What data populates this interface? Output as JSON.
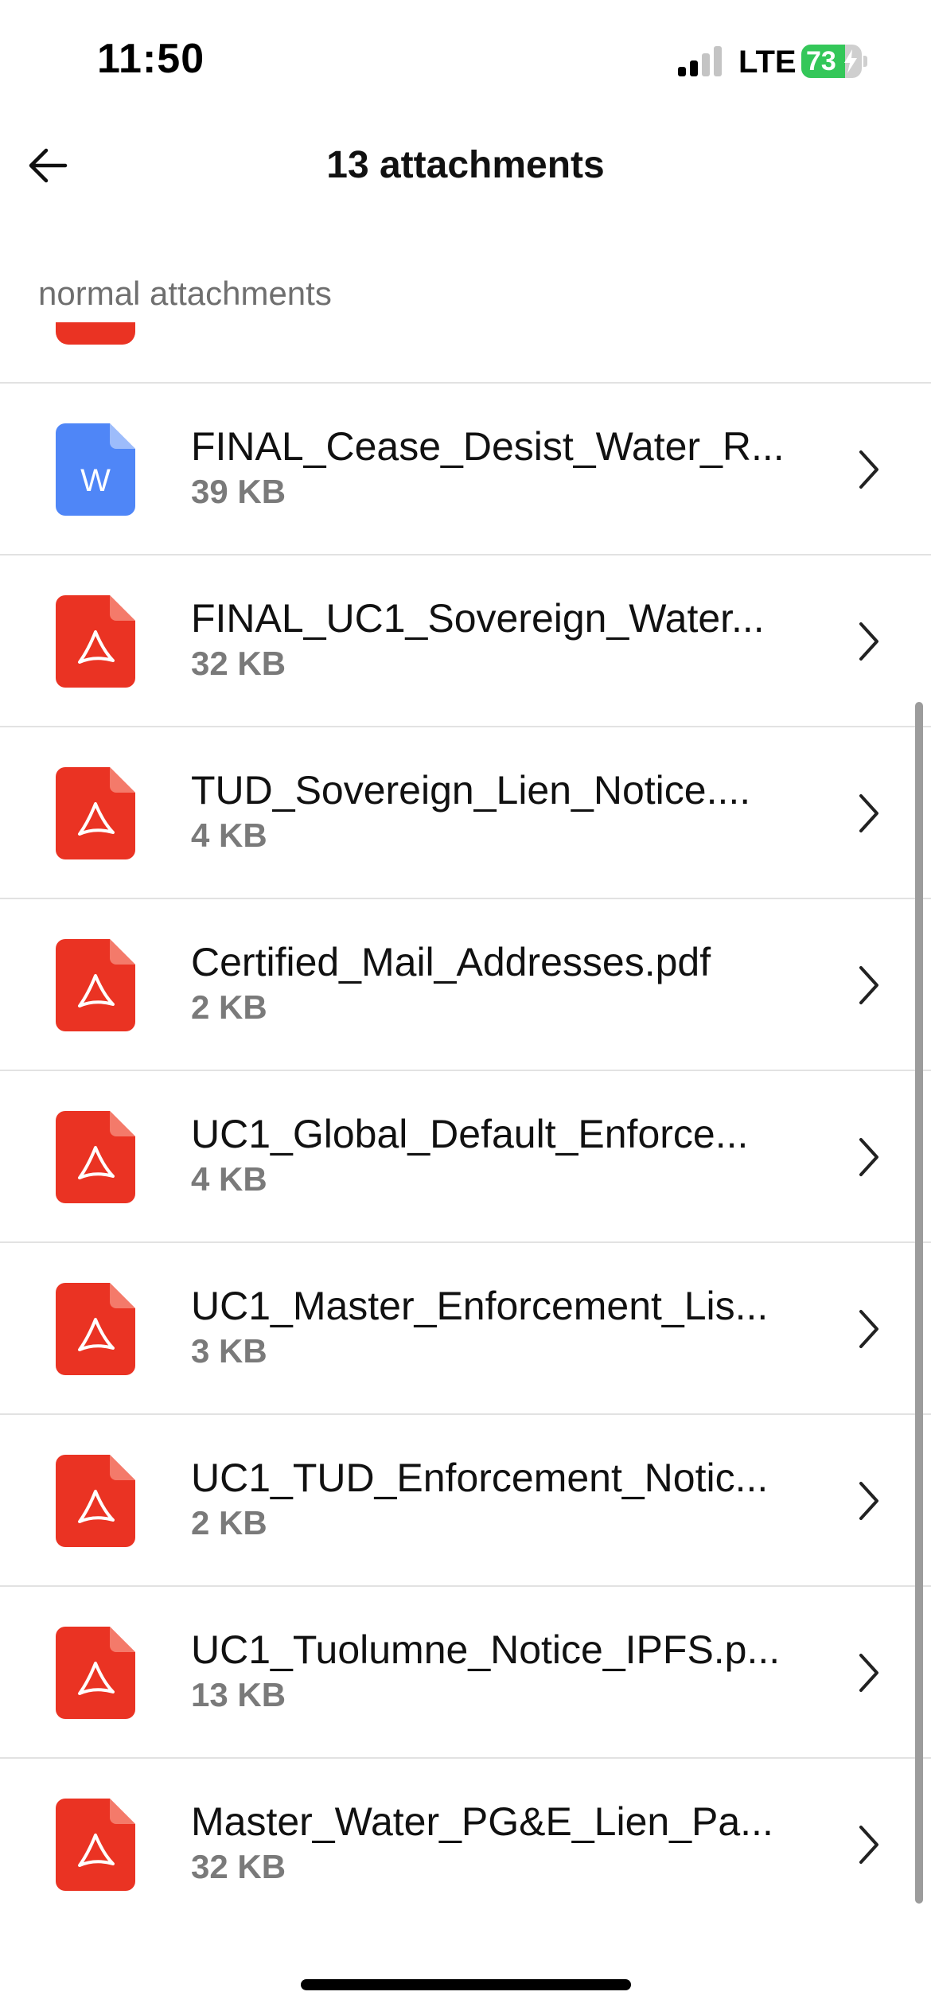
{
  "status_bar": {
    "time": "11:50",
    "network": "LTE",
    "battery": "73",
    "battery_level_percent": 73,
    "battery_color": "#34c759",
    "icons": [
      "signal-icon",
      "battery-charging-icon"
    ]
  },
  "header": {
    "title": "13 attachments",
    "back_icon": "arrow-left-icon"
  },
  "section": {
    "label": "normal attachments"
  },
  "colors": {
    "pdf_red": "#ea3323",
    "pdf_fold": "#f47a6a",
    "word_blue": "#4f86f7",
    "word_fold": "#9dbcfb"
  },
  "attachments": [
    {
      "name": "FINAL_Cease_Desist_Water_R...",
      "size": "39 KB",
      "type": "word",
      "icon": "word-file-icon",
      "badge": "W"
    },
    {
      "name": "FINAL_UC1_Sovereign_Water...",
      "size": "32 KB",
      "type": "pdf",
      "icon": "pdf-file-icon"
    },
    {
      "name": "TUD_Sovereign_Lien_Notice....",
      "size": "4 KB",
      "type": "pdf",
      "icon": "pdf-file-icon"
    },
    {
      "name": "Certified_Mail_Addresses.pdf",
      "size": "2 KB",
      "type": "pdf",
      "icon": "pdf-file-icon"
    },
    {
      "name": "UC1_Global_Default_Enforce...",
      "size": "4 KB",
      "type": "pdf",
      "icon": "pdf-file-icon"
    },
    {
      "name": "UC1_Master_Enforcement_Lis...",
      "size": "3 KB",
      "type": "pdf",
      "icon": "pdf-file-icon"
    },
    {
      "name": "UC1_TUD_Enforcement_Notic...",
      "size": "2 KB",
      "type": "pdf",
      "icon": "pdf-file-icon"
    },
    {
      "name": "UC1_Tuolumne_Notice_IPFS.p...",
      "size": "13 KB",
      "type": "pdf",
      "icon": "pdf-file-icon"
    },
    {
      "name": "Master_Water_PG&E_Lien_Pa...",
      "size": "32 KB",
      "type": "pdf",
      "icon": "pdf-file-icon"
    }
  ]
}
